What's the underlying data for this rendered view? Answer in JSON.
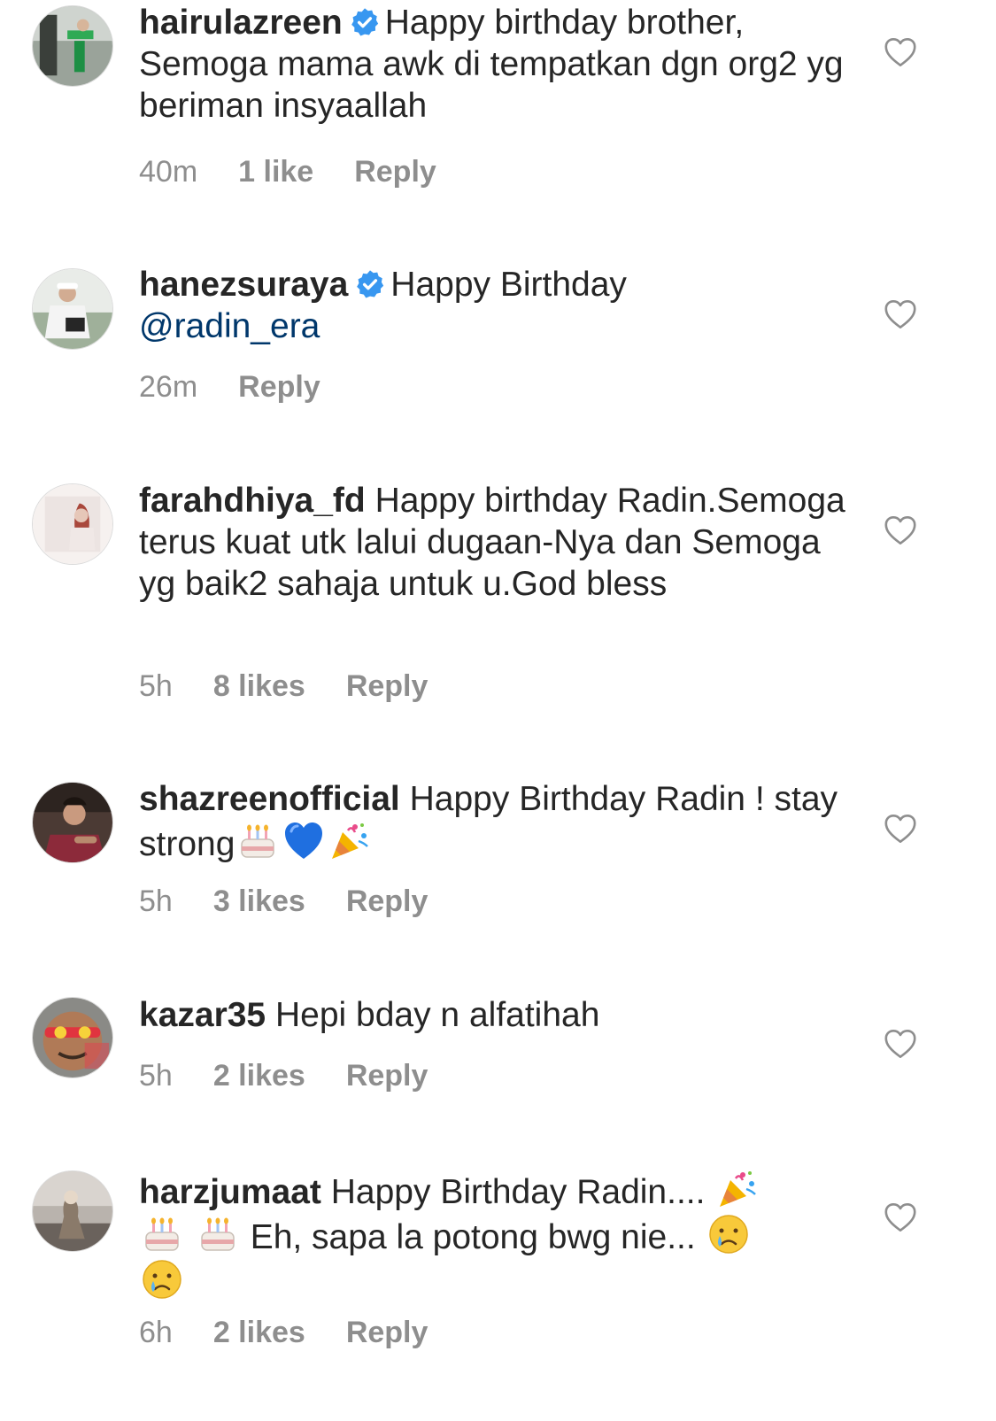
{
  "colors": {
    "text": "#262626",
    "secondary": "#8e8e8e",
    "mention": "#00376b",
    "verified": "#3897f0"
  },
  "comments": [
    {
      "username": "hairulazreen",
      "verified": true,
      "text": "Happy birthday brother, Semoga mama awk di tempatkan dgn org2 yg beriman insyaallah",
      "time": "40m",
      "likes": "1 like",
      "reply": "Reply"
    },
    {
      "username": "hanezsuraya",
      "verified": true,
      "text": "Happy Birthday",
      "mention": "@radin_era",
      "time": "26m",
      "likes": "",
      "reply": "Reply"
    },
    {
      "username": "farahdhiya_fd",
      "verified": false,
      "text": "Happy birthday Radin.Semoga terus kuat utk lalui dugaan-Nya dan Semoga yg baik2 sahaja untuk u.God bless",
      "time": "5h",
      "likes": "8 likes",
      "reply": "Reply"
    },
    {
      "username": "shazreenofficial",
      "verified": false,
      "text": "Happy Birthday Radin ! stay strong",
      "emojis": [
        "birthday-cake",
        "blue-heart",
        "party-popper"
      ],
      "time": "5h",
      "likes": "3 likes",
      "reply": "Reply"
    },
    {
      "username": "kazar35",
      "verified": false,
      "text": "Hepi bday n alfatihah",
      "time": "5h",
      "likes": "2 likes",
      "reply": "Reply"
    },
    {
      "username": "harzjumaat",
      "verified": false,
      "text_a": "Happy Birthday Radin....",
      "text_b": "Eh, sapa la potong bwg nie...",
      "emojis": [
        "party-popper",
        "birthday-cake",
        "birthday-cake",
        "crying-face",
        "crying-face"
      ],
      "time": "6h",
      "likes": "2 likes",
      "reply": "Reply"
    }
  ],
  "icons": {
    "like": "heart-outline-icon",
    "verified": "verified-badge-icon"
  }
}
